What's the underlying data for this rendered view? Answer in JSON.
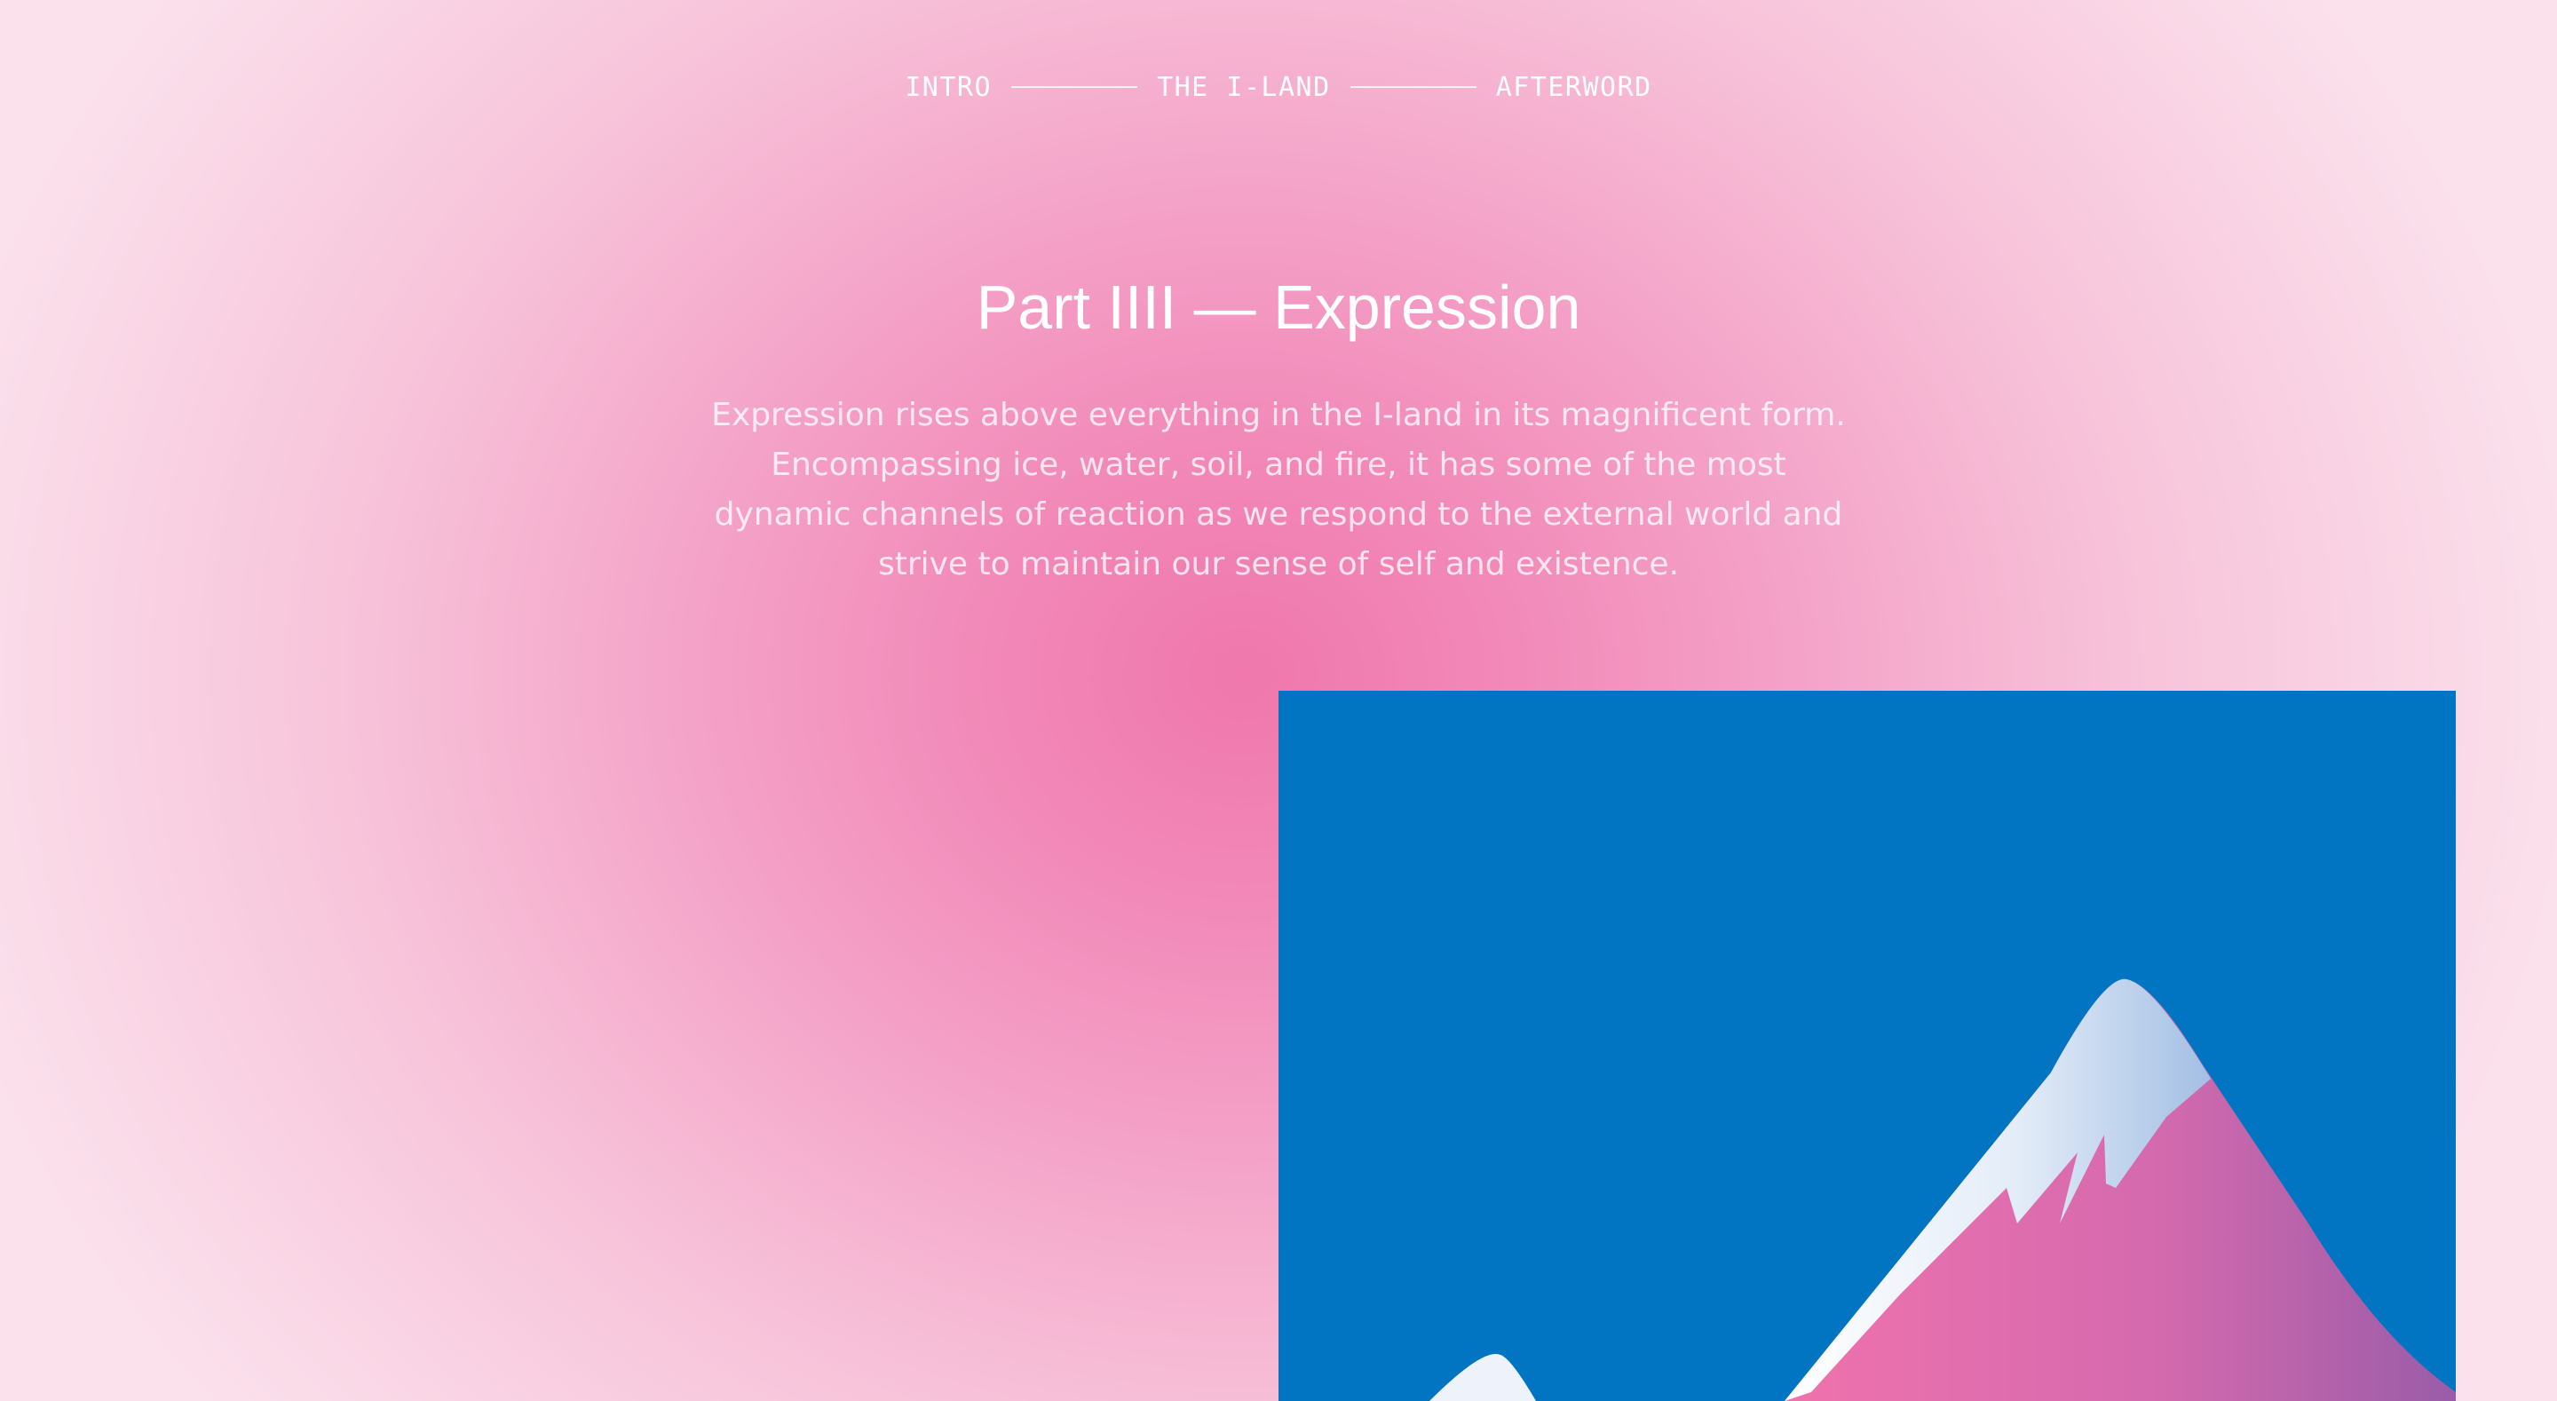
{
  "nav": {
    "items": [
      "INTRO",
      "THE I-LAND",
      "AFTERWORD"
    ]
  },
  "section": {
    "title": "Part IIII — Expression",
    "description": "Expression rises above everything in the I-land in its magnificent form. Encompassing ice, water, soil, and fire, it has some of the most dynamic channels of reaction as we respond to the external world and strive to maintain our sense of self and existence."
  },
  "illustration": {
    "subject": "mountain-illustration",
    "colors": {
      "sky": "#0175c2",
      "mountain_pink": "#e96aa8",
      "mountain_purple": "#9b5ea8",
      "snow": "#ffffff",
      "snow_shadow": "#a9c3e6"
    }
  }
}
